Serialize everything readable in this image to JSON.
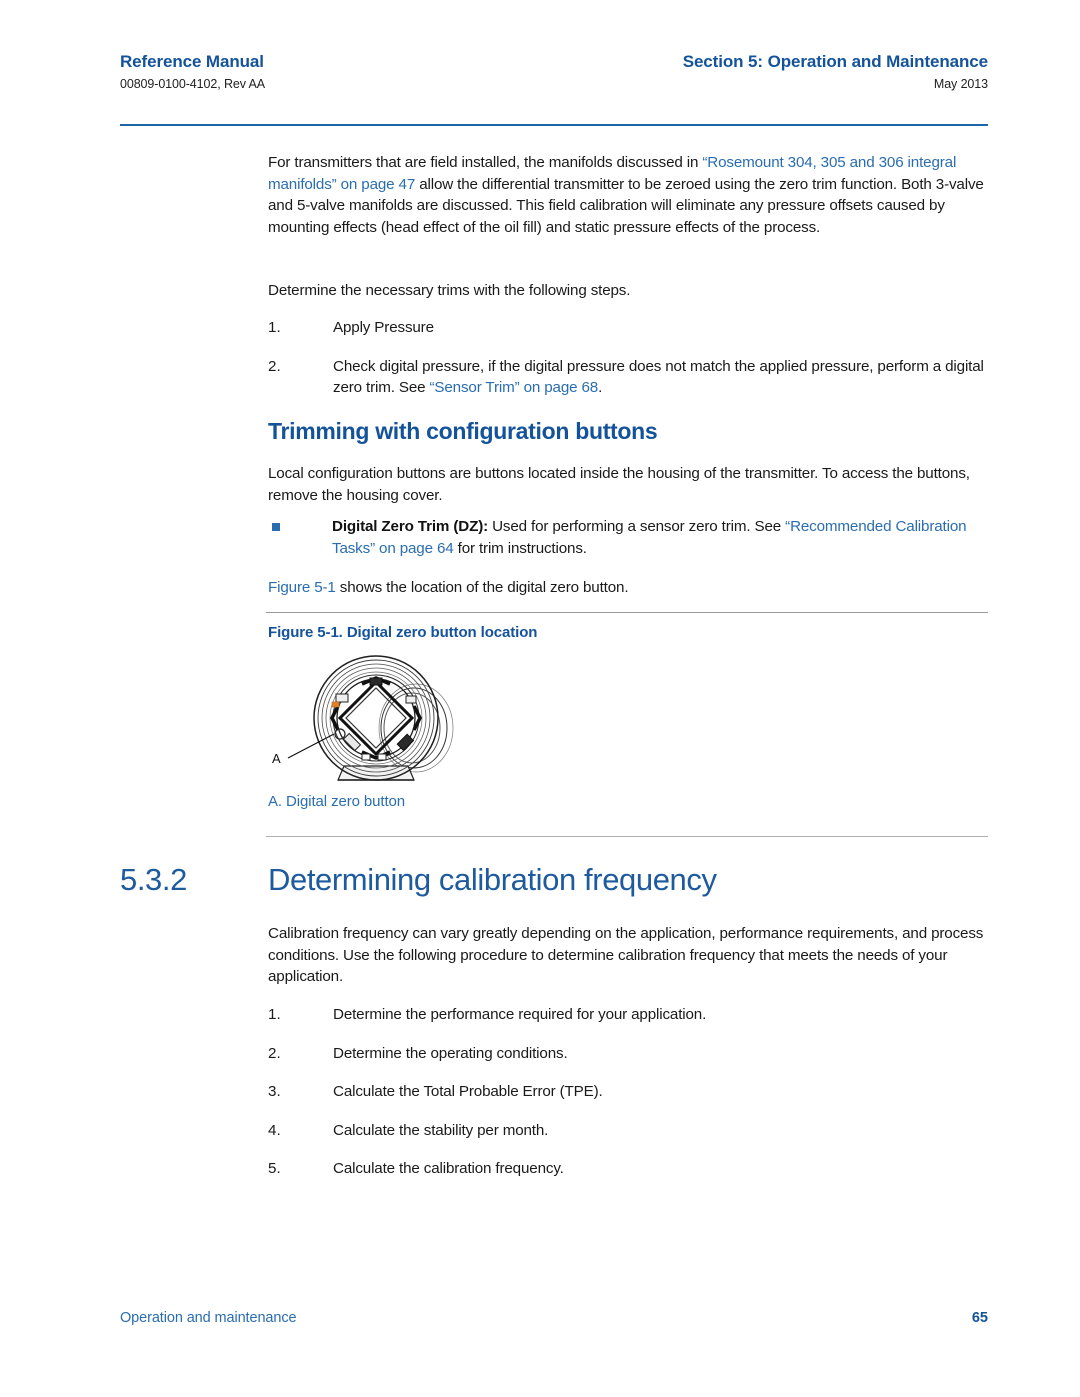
{
  "header": {
    "left_title": "Reference Manual",
    "left_sub": "00809-0100-4102, Rev AA",
    "right_title": "Section 5: Operation and Maintenance",
    "right_sub": "May 2013",
    "rule_color": "#1c66a8"
  },
  "colors": {
    "heading_blue": "#14539a",
    "link_blue": "#2a6db0",
    "section_blue": "#1d5a9e",
    "body_black": "#1a1a1a",
    "rule_gray": "#9b9b9b"
  },
  "body": {
    "para1_part1": "For transmitters that are field installed, the manifolds discussed in ",
    "para1_link": "“Rosemount 304, 305 and 306 integral manifolds” on page 47",
    "para1_part2": " allow the differential transmitter to be zeroed using the zero trim function. Both 3-valve and 5-valve manifolds are discussed. This field calibration will eliminate any pressure offsets caused by mounting effects (head effect of the oil fill) and static pressure effects of the process.",
    "para2": "Determine the necessary trims with the following steps.",
    "steps1": [
      {
        "num": "1.",
        "text": "Apply Pressure"
      },
      {
        "num": "2.",
        "text_part1": "Check digital pressure, if the digital pressure does not match the applied pressure, perform a digital zero trim. See ",
        "link": "“Sensor Trim” on page 68",
        "text_part2": "."
      }
    ],
    "subheading": "Trimming with configuration buttons",
    "para3": "Local configuration buttons are buttons located inside the housing of the transmitter. To access the buttons, remove the housing cover.",
    "bullet": {
      "marker": "square-bullet",
      "bold_label": "Digital Zero Trim (DZ):",
      "text_part1": " Used for performing a sensor zero trim. See ",
      "link": "“Recommended Calibration Tasks” on page 64",
      "text_part2": " for trim instructions."
    },
    "para4_link": "Figure 5-1",
    "para4_text": " shows the location of the digital zero button."
  },
  "figure": {
    "caption": "Figure 5-1. Digital zero button location",
    "callout_label": "A",
    "legend": "A. Digital zero button",
    "alt": "Line drawing of transmitter housing with digital zero button location"
  },
  "section": {
    "number": "5.3.2",
    "title": "Determining calibration frequency",
    "intro": "Calibration frequency can vary greatly depending on the application, performance requirements, and process conditions. Use the following procedure to determine calibration frequency that meets the needs of your application.",
    "steps": [
      {
        "num": "1.",
        "text": "Determine the performance required for your application."
      },
      {
        "num": "2.",
        "text": "Determine the operating conditions."
      },
      {
        "num": "3.",
        "text": "Calculate the Total Probable Error (TPE)."
      },
      {
        "num": "4.",
        "text": "Calculate the stability per month."
      },
      {
        "num": "5.",
        "text": "Calculate the calibration frequency."
      }
    ]
  },
  "footer": {
    "left": "Operation and maintenance",
    "page_number": "65"
  }
}
